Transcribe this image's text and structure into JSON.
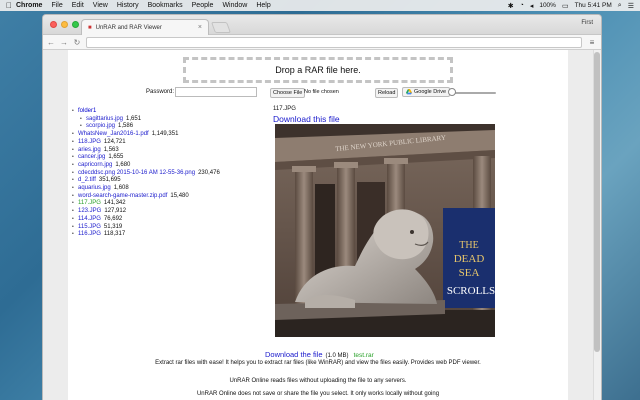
{
  "menubar": {
    "app": "Chrome",
    "items": [
      "File",
      "Edit",
      "View",
      "History",
      "Bookmarks",
      "People",
      "Window",
      "Help"
    ],
    "battery": "100%",
    "time": "Thu 5:41 PM"
  },
  "browser": {
    "tab_title": "UnRAR and RAR Viewer",
    "user": "First"
  },
  "page": {
    "dropzone": "Drop a RAR file here.",
    "password_label": "Password:",
    "choose_file": "Choose File",
    "no_file": "No file chosen",
    "reload": "Reload",
    "google_drive": "Google Drive",
    "tree": [
      {
        "name": "folder1",
        "size": "",
        "type": "folder",
        "indent": 0
      },
      {
        "name": "sagittarius.jpg",
        "size": "1,651",
        "type": "file",
        "indent": 1
      },
      {
        "name": "scorpio.jpg",
        "size": "1,586",
        "type": "file",
        "indent": 1
      },
      {
        "name": "WhatsNew_Jan2016-1.pdf",
        "size": "1,149,351",
        "type": "file",
        "indent": 0
      },
      {
        "name": "118.JPG",
        "size": "124,721",
        "type": "file",
        "indent": 0
      },
      {
        "name": "aries.jpg",
        "size": "1,563",
        "type": "file",
        "indent": 0
      },
      {
        "name": "cancer.jpg",
        "size": "1,655",
        "type": "file",
        "indent": 0
      },
      {
        "name": "capricorn.jpg",
        "size": "1,680",
        "type": "file",
        "indent": 0
      },
      {
        "name": "cdecddsc.png 2015-10-16 AM 12-55-36.png",
        "size": "230,476",
        "type": "file",
        "indent": 0
      },
      {
        "name": "d_2.tiff",
        "size": "351,695",
        "type": "file",
        "indent": 0
      },
      {
        "name": "aquarius.jpg",
        "size": "1,608",
        "type": "file",
        "indent": 0
      },
      {
        "name": "word-search-game-master.zip.pdf",
        "size": "15,480",
        "type": "file",
        "indent": 0
      },
      {
        "name": "117.JPG",
        "size": "141,342",
        "type": "visited",
        "indent": 0
      },
      {
        "name": "123.JPG",
        "size": "127,912",
        "type": "file",
        "indent": 0
      },
      {
        "name": "114.JPG",
        "size": "76,692",
        "type": "file",
        "indent": 0
      },
      {
        "name": "115.JPG",
        "size": "51,319",
        "type": "file",
        "indent": 0
      },
      {
        "name": "116.JPG",
        "size": "118,317",
        "type": "file",
        "indent": 0
      }
    ],
    "preview_name": "117.JPG",
    "download_link": "Download this file",
    "photo_text": {
      "frieze": "THE NEW YORK PUBLIC LIBRARY",
      "banner_the": "THE",
      "banner_dead": "DEAD",
      "banner_sea": "SEA",
      "banner_scrolls": "SCROLLS"
    },
    "download_footer": "Download the file",
    "download_size": "(1.0 MB)",
    "download_filename": "test.rar",
    "desc1": "Extract rar files with ease! It helps you to extract rar files (like WinRAR) and view the files easily. Provides web PDF viewer.",
    "desc2": "UnRAR Online reads files without uploading the file to any servers.",
    "desc3": "UnRAR Online does not save or share the file you select. It only works locally without going"
  }
}
